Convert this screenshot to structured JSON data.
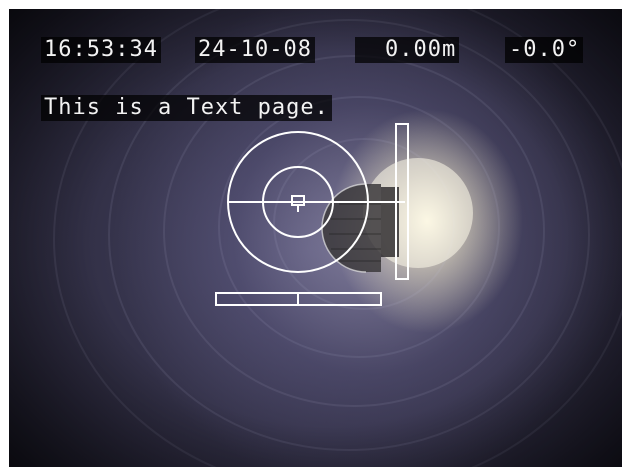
{
  "hud": {
    "time": "16:53:34",
    "date": "24-10-08",
    "distance": "0.00m",
    "angle": "-0.0°",
    "text_page": "This is a Text page."
  },
  "colors": {
    "overlay_line": "#ffffff",
    "hud_background": "#000000",
    "hud_text": "#f2f2f2"
  },
  "icons": {
    "center_marker": "target-marker-icon"
  }
}
